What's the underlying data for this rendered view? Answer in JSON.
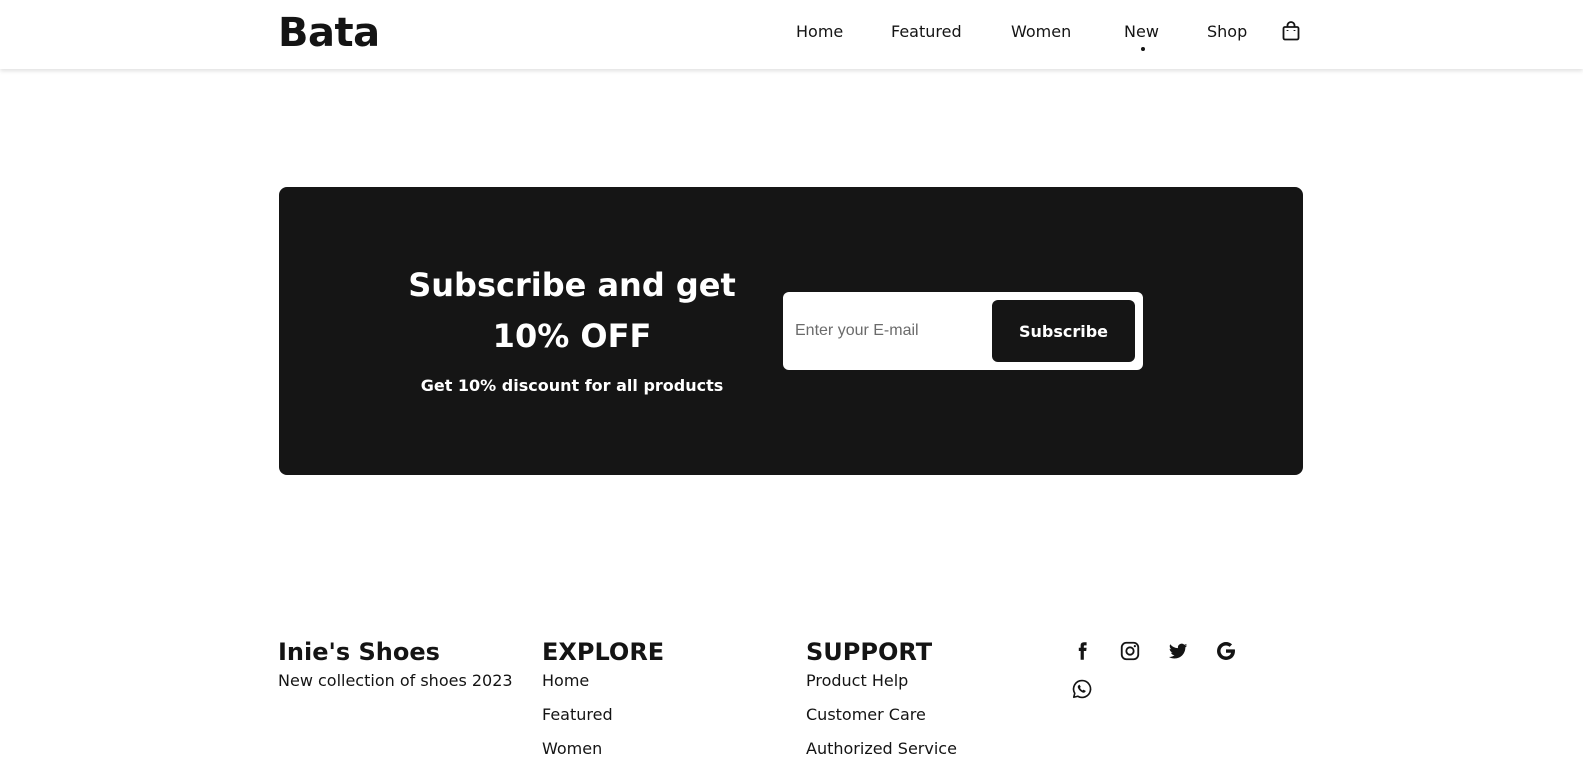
{
  "header": {
    "logo": "Bata",
    "nav": [
      {
        "label": "Home"
      },
      {
        "label": "Featured"
      },
      {
        "label": "Women"
      },
      {
        "label": "New",
        "active": true
      },
      {
        "label": "Shop"
      }
    ],
    "cart_icon": "shopping-bag-icon"
  },
  "subscribe": {
    "title_line1": "Subscribe and get",
    "title_line2": "10% OFF",
    "subtitle": "Get 10% discount for all products",
    "input_placeholder": "Enter your E-mail",
    "input_value": "",
    "button_label": "Subscribe"
  },
  "footer": {
    "brand": {
      "title": "Inie's Shoes",
      "text": "New collection of shoes 2023"
    },
    "explore": {
      "title": "EXPLORE",
      "links": [
        "Home",
        "Featured",
        "Women"
      ]
    },
    "support": {
      "title": "SUPPORT",
      "links": [
        "Product Help",
        "Customer Care",
        "Authorized Service"
      ]
    },
    "social_icons": [
      "facebook-icon",
      "instagram-icon",
      "twitter-icon",
      "google-icon",
      "whatsapp-icon"
    ]
  },
  "colors": {
    "primary": "#141414",
    "banner_bg": "#151515",
    "background": "#ffffff"
  }
}
